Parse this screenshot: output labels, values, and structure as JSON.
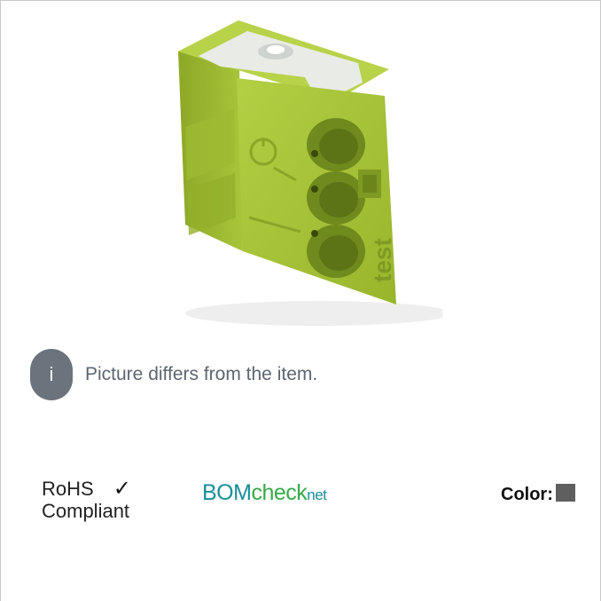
{
  "info": {
    "icon_letter": "i",
    "message": "Picture differs from the item."
  },
  "product": {
    "imprint_text": "test",
    "alt": "Green push-wire connector"
  },
  "rohs": {
    "line1": "RoHS",
    "line2": "Compliant",
    "check_glyph": "✓"
  },
  "bomcheck": {
    "part1": "BOM",
    "part2": "check",
    "part3": "net"
  },
  "color": {
    "label": "Color:",
    "swatch_hex": "#5f5f5f"
  },
  "palette": {
    "connector_green": "#a4c23a",
    "connector_shadow": "#7f9a22",
    "badge_gray": "#6b737d"
  }
}
